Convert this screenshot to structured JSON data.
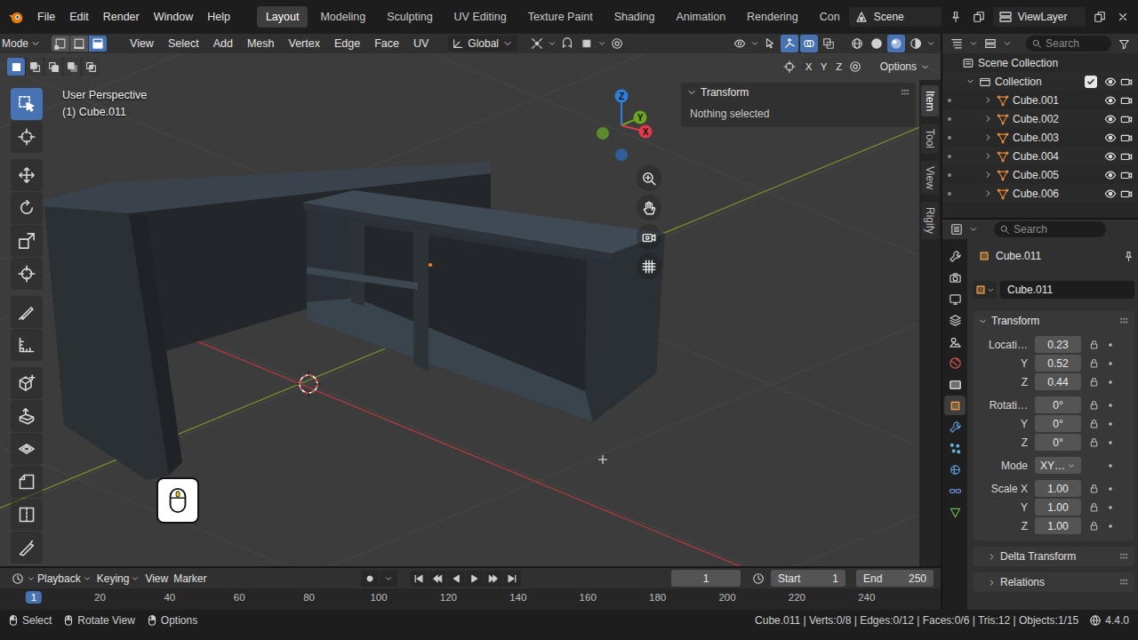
{
  "topbar": {
    "menus": [
      "File",
      "Edit",
      "Render",
      "Window",
      "Help"
    ],
    "workspaces": [
      {
        "label": "Layout",
        "selected": true
      },
      {
        "label": "Modeling",
        "selected": false
      },
      {
        "label": "Sculpting",
        "selected": false
      },
      {
        "label": "UV Editing",
        "selected": false
      },
      {
        "label": "Texture Paint",
        "selected": false
      },
      {
        "label": "Shading",
        "selected": false
      },
      {
        "label": "Animation",
        "selected": false
      },
      {
        "label": "Rendering",
        "selected": false
      },
      {
        "label": "Con",
        "selected": false
      }
    ],
    "scene": "Scene",
    "view_layer": "ViewLayer"
  },
  "viewport_header": {
    "mode": "Mode",
    "select_modes": [
      {
        "kind": "vertex",
        "selected": false
      },
      {
        "kind": "edge",
        "selected": false
      },
      {
        "kind": "face",
        "selected": true
      }
    ],
    "menus": [
      "View",
      "Select",
      "Add",
      "Mesh",
      "Vertex",
      "Edge",
      "Face",
      "UV"
    ],
    "orientation": "Global",
    "toggles": [
      {
        "kind": "gizmo",
        "on": true
      },
      {
        "kind": "overlay",
        "on": true
      },
      {
        "kind": "xray",
        "on": false
      }
    ],
    "shading": [
      {
        "kind": "wireframe",
        "selected": false
      },
      {
        "kind": "solid",
        "selected": false
      },
      {
        "kind": "material",
        "selected": true
      },
      {
        "kind": "rendered",
        "selected": false
      }
    ]
  },
  "tool_settings": {
    "box_modes": [
      {
        "kind": "new",
        "selected": true
      },
      {
        "kind": "extend",
        "selected": false
      },
      {
        "kind": "subtract",
        "selected": false
      },
      {
        "kind": "invert",
        "selected": false
      },
      {
        "kind": "intersect",
        "selected": false
      }
    ],
    "axes": [
      "X",
      "Y",
      "Z"
    ],
    "options": "Options"
  },
  "toolbar": {
    "tools": [
      {
        "kind": "select",
        "selected": true
      },
      {
        "kind": "cursor",
        "selected": false
      },
      {
        "kind": "move",
        "selected": false
      },
      {
        "kind": "rotate",
        "selected": false
      },
      {
        "kind": "scale",
        "selected": false
      },
      {
        "kind": "transform",
        "selected": false
      },
      {
        "kind": "annotate",
        "selected": false
      },
      {
        "kind": "measure",
        "selected": false
      },
      {
        "kind": "addcube",
        "selected": false
      },
      {
        "kind": "extrude",
        "selected": false
      },
      {
        "kind": "inset",
        "selected": false
      },
      {
        "kind": "bevel",
        "selected": false
      },
      {
        "kind": "loopcut",
        "selected": false
      },
      {
        "kind": "knife",
        "selected": false
      }
    ]
  },
  "viewport": {
    "view_name": "User Perspective",
    "object_info": "(1) Cube.011",
    "gizmo": {
      "axes": [
        {
          "label": "Z",
          "color": "#2e7fdc"
        },
        {
          "label": "Y",
          "color": "#6ea51f"
        },
        {
          "label": "X",
          "color": "#e2394b"
        }
      ],
      "negative_axes": [
        {
          "color": "#5d8a2c"
        },
        {
          "color": "#2f5e98"
        }
      ]
    }
  },
  "n_panel": {
    "title": "Transform",
    "message": "Nothing selected",
    "tabs": [
      {
        "label": "Item",
        "selected": true
      },
      {
        "label": "Tool",
        "selected": false
      },
      {
        "label": "View",
        "selected": false
      },
      {
        "label": "Rigify",
        "selected": false
      }
    ]
  },
  "outliner": {
    "search_placeholder": "Search",
    "root": "Scene Collection",
    "collection": {
      "name": "Collection",
      "checked": true
    },
    "objects": [
      "Cube.001",
      "Cube.002",
      "Cube.003",
      "Cube.004",
      "Cube.005",
      "Cube.006"
    ]
  },
  "properties": {
    "search_placeholder": "Search",
    "tabs": [
      {
        "kind": "tool",
        "selected": false
      },
      {
        "kind": "render",
        "selected": false
      },
      {
        "kind": "output",
        "selected": false
      },
      {
        "kind": "viewlayer",
        "selected": false
      },
      {
        "kind": "scene",
        "selected": false
      },
      {
        "kind": "world",
        "selected": false
      },
      {
        "kind": "collection",
        "selected": false
      },
      {
        "kind": "object",
        "selected": true
      },
      {
        "kind": "modifier",
        "selected": false
      },
      {
        "kind": "particles",
        "selected": false
      },
      {
        "kind": "physics",
        "selected": false
      },
      {
        "kind": "constraints",
        "selected": false
      },
      {
        "kind": "data",
        "selected": false
      }
    ],
    "object_name": "Cube.011",
    "data_name": "Cube.011",
    "transform": {
      "title": "Transform",
      "groups": [
        [
          {
            "label": "Locati…",
            "value": "0.23",
            "kind": "number"
          },
          {
            "label": "Y",
            "value": "0.52",
            "kind": "number"
          },
          {
            "label": "Z",
            "value": "0.44",
            "kind": "number"
          }
        ],
        [
          {
            "label": "Rotati…",
            "value": "0°",
            "kind": "number"
          },
          {
            "label": "Y",
            "value": "0°",
            "kind": "number"
          },
          {
            "label": "Z",
            "value": "0°",
            "kind": "number"
          }
        ],
        [
          {
            "label": "Mode",
            "value": "XY…",
            "kind": "dropdown"
          }
        ],
        [
          {
            "label": "Scale X",
            "value": "1.00",
            "kind": "number"
          },
          {
            "label": "Y",
            "value": "1.00",
            "kind": "number"
          },
          {
            "label": "Z",
            "value": "1.00",
            "kind": "number"
          }
        ]
      ]
    },
    "subpanels": [
      {
        "label": "Delta Transform",
        "expanded": false
      },
      {
        "label": "Relations",
        "expanded": false
      }
    ]
  },
  "timeline": {
    "menus": [
      "Playback",
      "Keying",
      "View",
      "Marker"
    ],
    "current_frame": "1",
    "start_label": "Start",
    "start": "1",
    "end_label": "End",
    "end": "250",
    "ruler": [
      {
        "label": "1",
        "selected": true
      },
      {
        "label": "20",
        "selected": false
      },
      {
        "label": "40",
        "selected": false
      },
      {
        "label": "60",
        "selected": false
      },
      {
        "label": "80",
        "selected": false
      },
      {
        "label": "100",
        "selected": false
      },
      {
        "label": "120",
        "selected": false
      },
      {
        "label": "140",
        "selected": false
      },
      {
        "label": "160",
        "selected": false
      },
      {
        "label": "180",
        "selected": false
      },
      {
        "label": "200",
        "selected": false
      },
      {
        "label": "220",
        "selected": false
      },
      {
        "label": "240",
        "selected": false
      }
    ]
  },
  "status_bar": {
    "hints": [
      "Select",
      "Rotate View",
      "Options"
    ],
    "stats": "Cube.011 | Verts:0/8 | Edges:0/12 | Faces:0/6 | Tris:12 | Objects:1/15",
    "version": "4.4.0"
  }
}
